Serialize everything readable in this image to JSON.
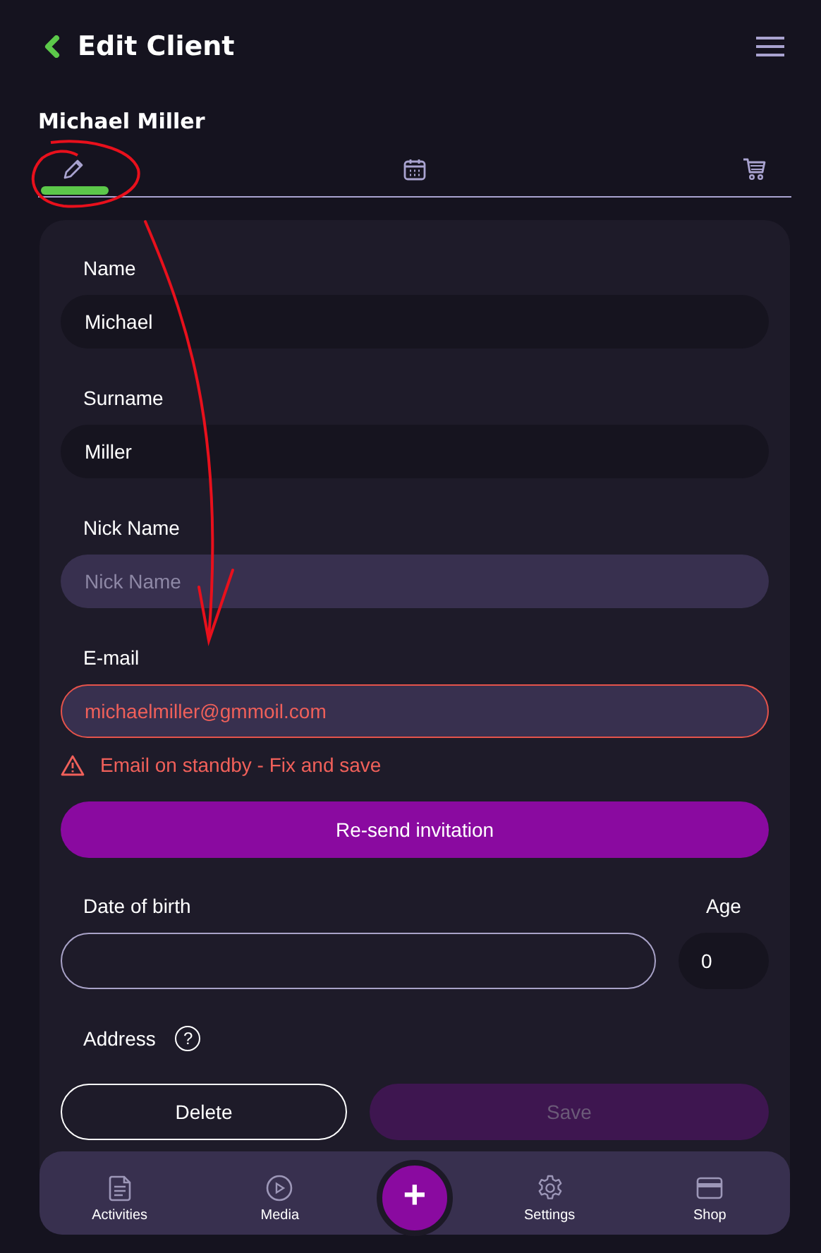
{
  "header": {
    "title": "Edit Client"
  },
  "client_name": "Michael Miller",
  "tabs": [
    {
      "kind": "edit",
      "selected": true
    },
    {
      "kind": "calendar",
      "selected": false
    },
    {
      "kind": "cart",
      "selected": false
    }
  ],
  "fields": [
    {
      "label": "Name",
      "value": "Michael",
      "error": false
    },
    {
      "label": "Surname",
      "value": "Miller",
      "error": false
    },
    {
      "label": "Nick Name",
      "placeholder": "Nick Name",
      "error": false
    },
    {
      "label": "E-mail",
      "value": "michaelmiller@gmmoil.com",
      "error": true,
      "error_message": "Email on standby - Fix and save"
    }
  ],
  "resend_button": "Re-send invitation",
  "date_of_birth": {
    "label": "Date of birth",
    "age_label": "Age",
    "age_value": "0"
  },
  "address": {
    "label": "Address",
    "help": "?"
  },
  "actions": [
    {
      "kind": "outline",
      "label": "Delete",
      "disabled": false
    },
    {
      "kind": "primary",
      "label": "Save",
      "disabled": true
    }
  ],
  "bottom_nav": [
    {
      "kind": "document",
      "label": "Activities"
    },
    {
      "kind": "play",
      "label": "Media"
    },
    {
      "kind": "fab",
      "label": "+"
    },
    {
      "kind": "gear",
      "label": "Settings"
    },
    {
      "kind": "card",
      "label": "Shop"
    }
  ]
}
